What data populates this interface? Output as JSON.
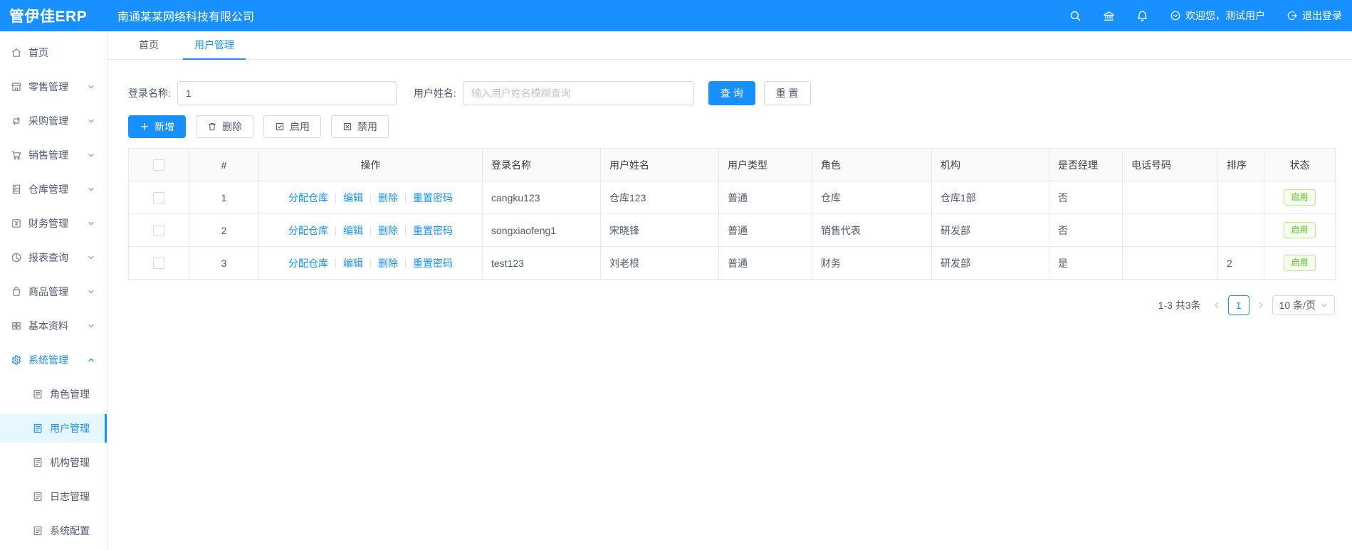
{
  "header": {
    "logo": "管伊佳ERP",
    "company": "南通某某网络科技有限公司",
    "welcome": "欢迎您，测试用户",
    "logout": "退出登录"
  },
  "tabs": [
    {
      "label": "首页"
    },
    {
      "label": "用户管理"
    }
  ],
  "sidebar": {
    "items": [
      {
        "label": "首页"
      },
      {
        "label": "零售管理"
      },
      {
        "label": "采购管理"
      },
      {
        "label": "销售管理"
      },
      {
        "label": "仓库管理"
      },
      {
        "label": "财务管理"
      },
      {
        "label": "报表查询"
      },
      {
        "label": "商品管理"
      },
      {
        "label": "基本资料"
      },
      {
        "label": "系统管理"
      }
    ],
    "subitems": [
      {
        "label": "角色管理"
      },
      {
        "label": "用户管理"
      },
      {
        "label": "机构管理"
      },
      {
        "label": "日志管理"
      },
      {
        "label": "系统配置"
      }
    ]
  },
  "search": {
    "login_label": "登录名称:",
    "login_value": "1",
    "name_label": "用户姓名:",
    "name_placeholder": "输入用户姓名模糊查询",
    "query_label": "查 询",
    "reset_label": "重 置"
  },
  "toolbar": {
    "add": "新增",
    "delete": "删除",
    "enable": "启用",
    "disable": "禁用"
  },
  "table": {
    "headers": [
      "#",
      "操作",
      "登录名称",
      "用户姓名",
      "用户类型",
      "角色",
      "机构",
      "是否经理",
      "电话号码",
      "排序",
      "状态"
    ],
    "actions": [
      "分配仓库",
      "编辑",
      "删除",
      "重置密码"
    ],
    "rows": [
      {
        "index": "1",
        "login": "cangku123",
        "name": "仓库123",
        "type": "普通",
        "role": "仓库",
        "org": "仓库1部",
        "manager": "否",
        "phone": "",
        "sort": "",
        "status": "启用"
      },
      {
        "index": "2",
        "login": "songxiaofeng1",
        "name": "宋晓锋",
        "type": "普通",
        "role": "销售代表",
        "org": "研发部",
        "manager": "否",
        "phone": "",
        "sort": "",
        "status": "启用"
      },
      {
        "index": "3",
        "login": "test123",
        "name": "刘老根",
        "type": "普通",
        "role": "财务",
        "org": "研发部",
        "manager": "是",
        "phone": "",
        "sort": "2",
        "status": "启用"
      }
    ]
  },
  "pagination": {
    "total": "1-3 共3条",
    "current_page": "1",
    "page_size": "10 条/页"
  },
  "colors": {
    "primary": "#1890ff",
    "success_text": "#52c41a",
    "success_border": "#b7eb8f",
    "success_bg": "#f6ffed"
  }
}
